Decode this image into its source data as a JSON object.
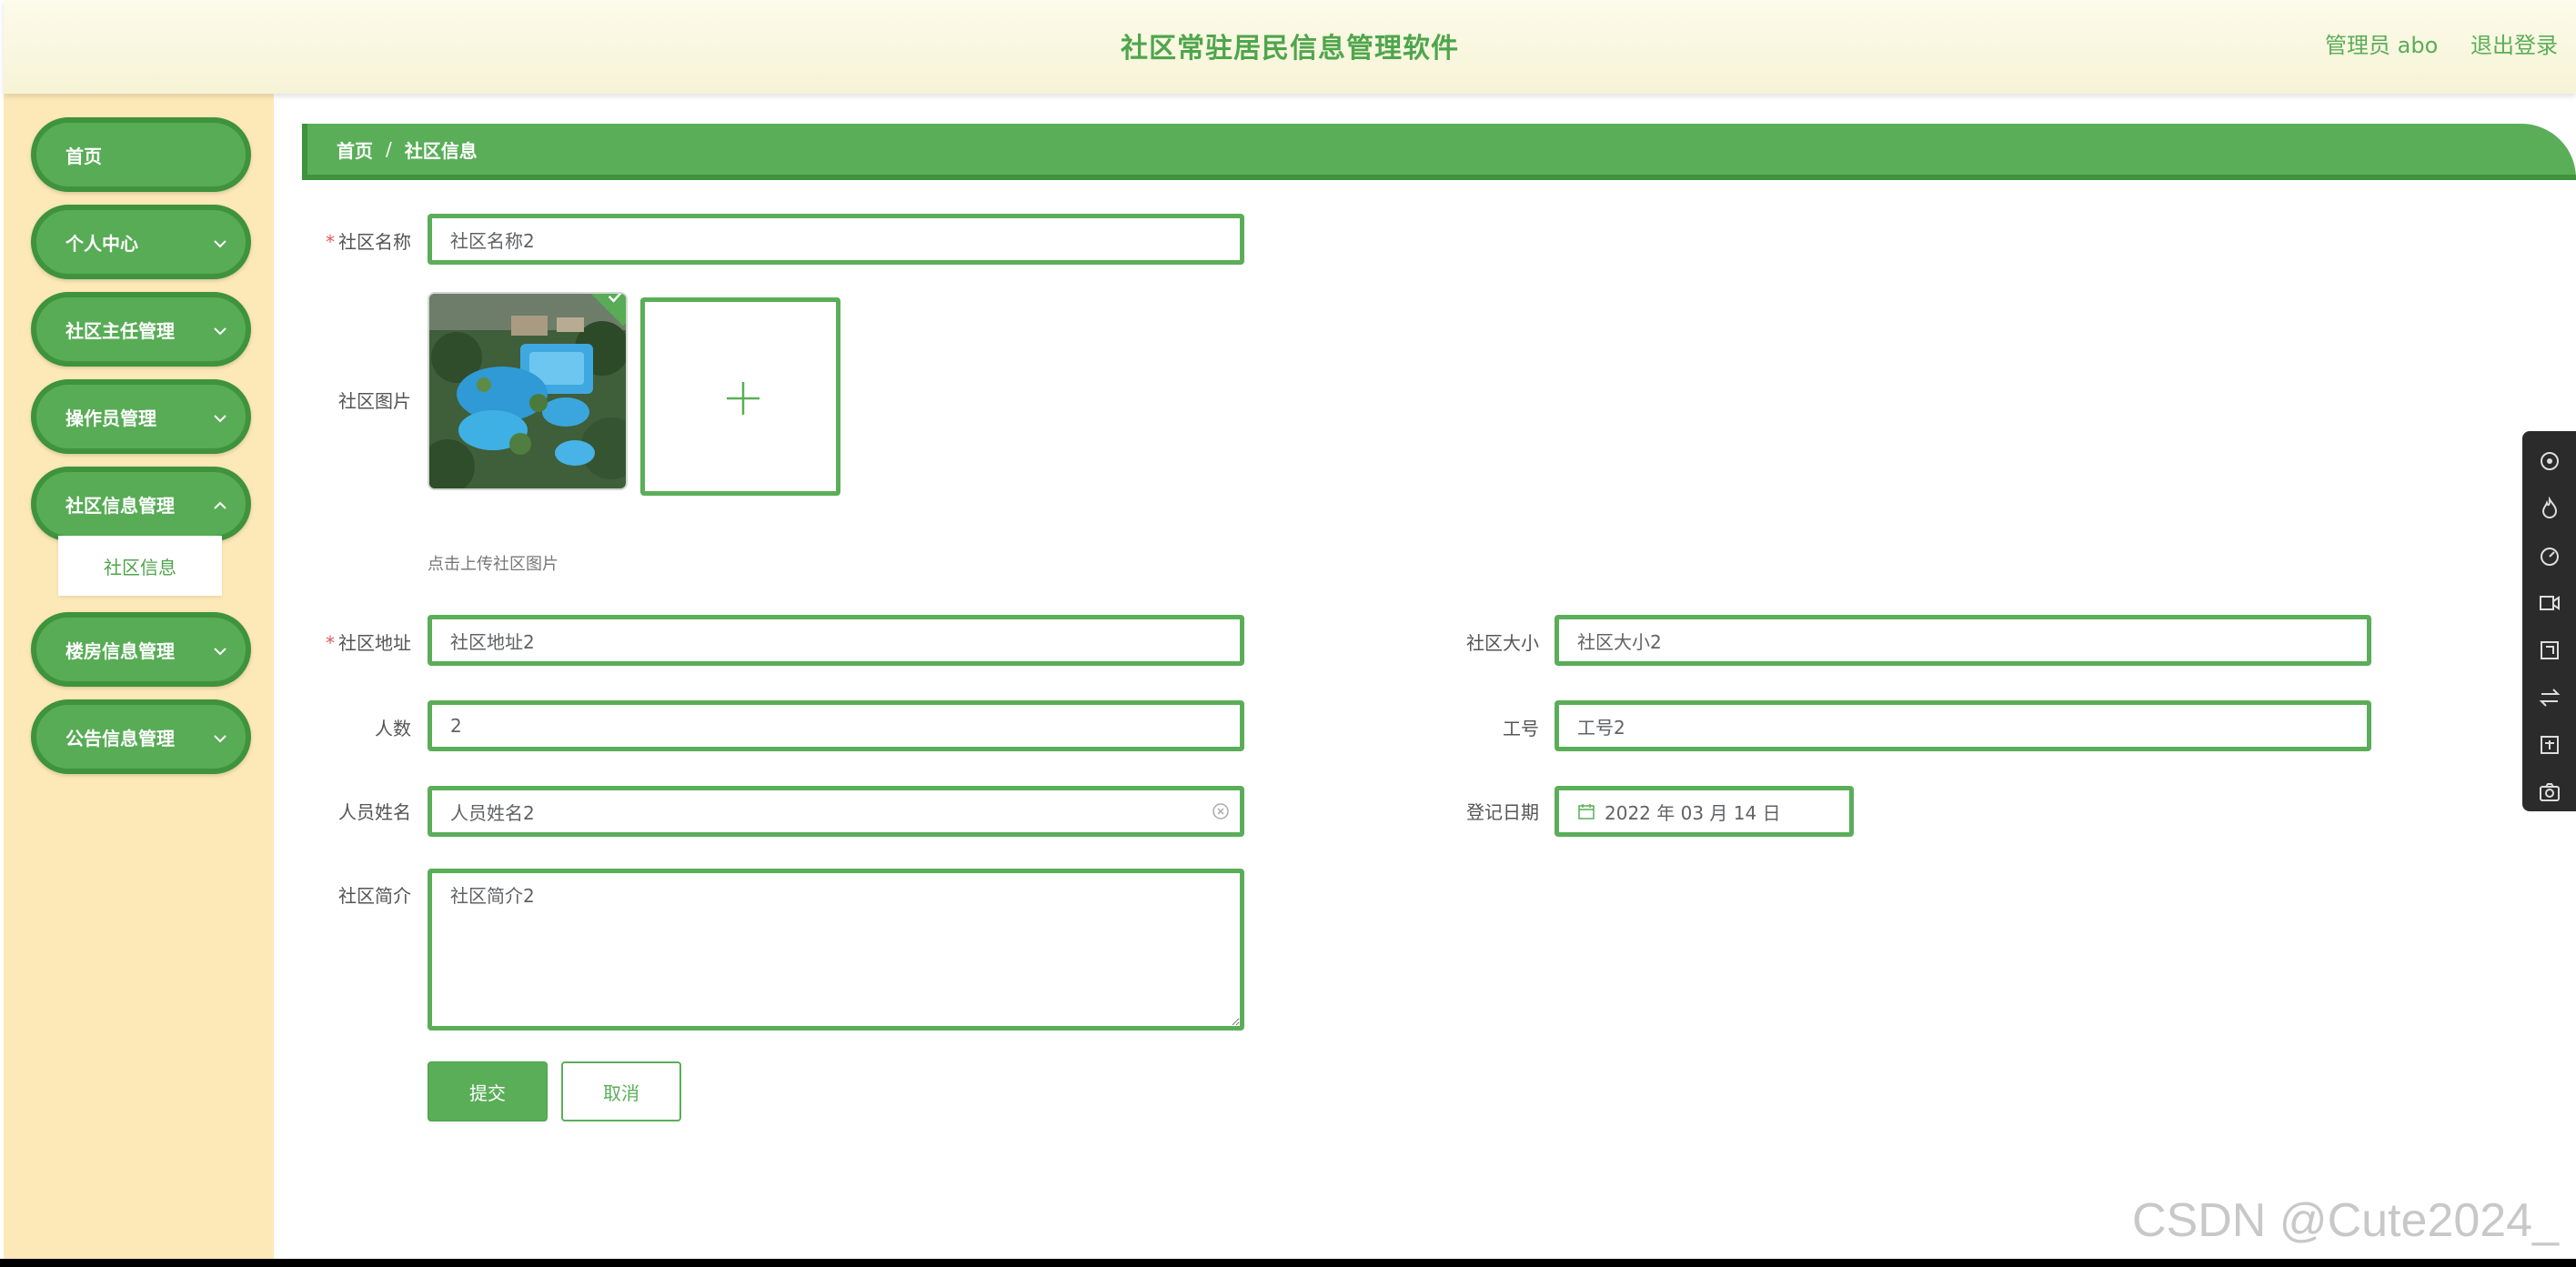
{
  "header": {
    "title": "社区常驻居民信息管理软件",
    "user_label": "管理员 abo",
    "logout_label": "退出登录"
  },
  "sidebar": {
    "items": [
      {
        "label": "首页"
      },
      {
        "label": "个人中心"
      },
      {
        "label": "社区主任管理"
      },
      {
        "label": "操作员管理"
      },
      {
        "label": "社区信息管理"
      },
      {
        "label": "楼房信息管理"
      },
      {
        "label": "公告信息管理"
      }
    ],
    "submenu_label": "社区信息"
  },
  "breadcrumb": {
    "home": "首页",
    "separator": "/",
    "current": "社区信息"
  },
  "form": {
    "name": {
      "label": "社区名称",
      "value": "社区名称2"
    },
    "image": {
      "label": "社区图片",
      "hint": "点击上传社区图片"
    },
    "address": {
      "label": "社区地址",
      "value": "社区地址2"
    },
    "size": {
      "label": "社区大小",
      "value": "社区大小2"
    },
    "count": {
      "label": "人数",
      "value": "2"
    },
    "job_no": {
      "label": "工号",
      "value": "工号2"
    },
    "person_name": {
      "label": "人员姓名",
      "value": "人员姓名2"
    },
    "reg_date": {
      "label": "登记日期",
      "value": "2022 年 03 月 14 日"
    },
    "intro": {
      "label": "社区简介",
      "value": "社区简介2"
    },
    "required_mark": "*",
    "submit_label": "提交",
    "cancel_label": "取消"
  },
  "watermark": "CSDN @Cute2024_",
  "colors": {
    "primary": "#5aae58",
    "primary_dark": "#3e933c",
    "sidebar_bg": "#fde9b8",
    "header_bg": "#fdfbea"
  },
  "icons": [
    "chevron-down-icon",
    "check-icon",
    "plus-icon",
    "clear-circle-icon",
    "calendar-icon",
    "toolbar-icons"
  ]
}
